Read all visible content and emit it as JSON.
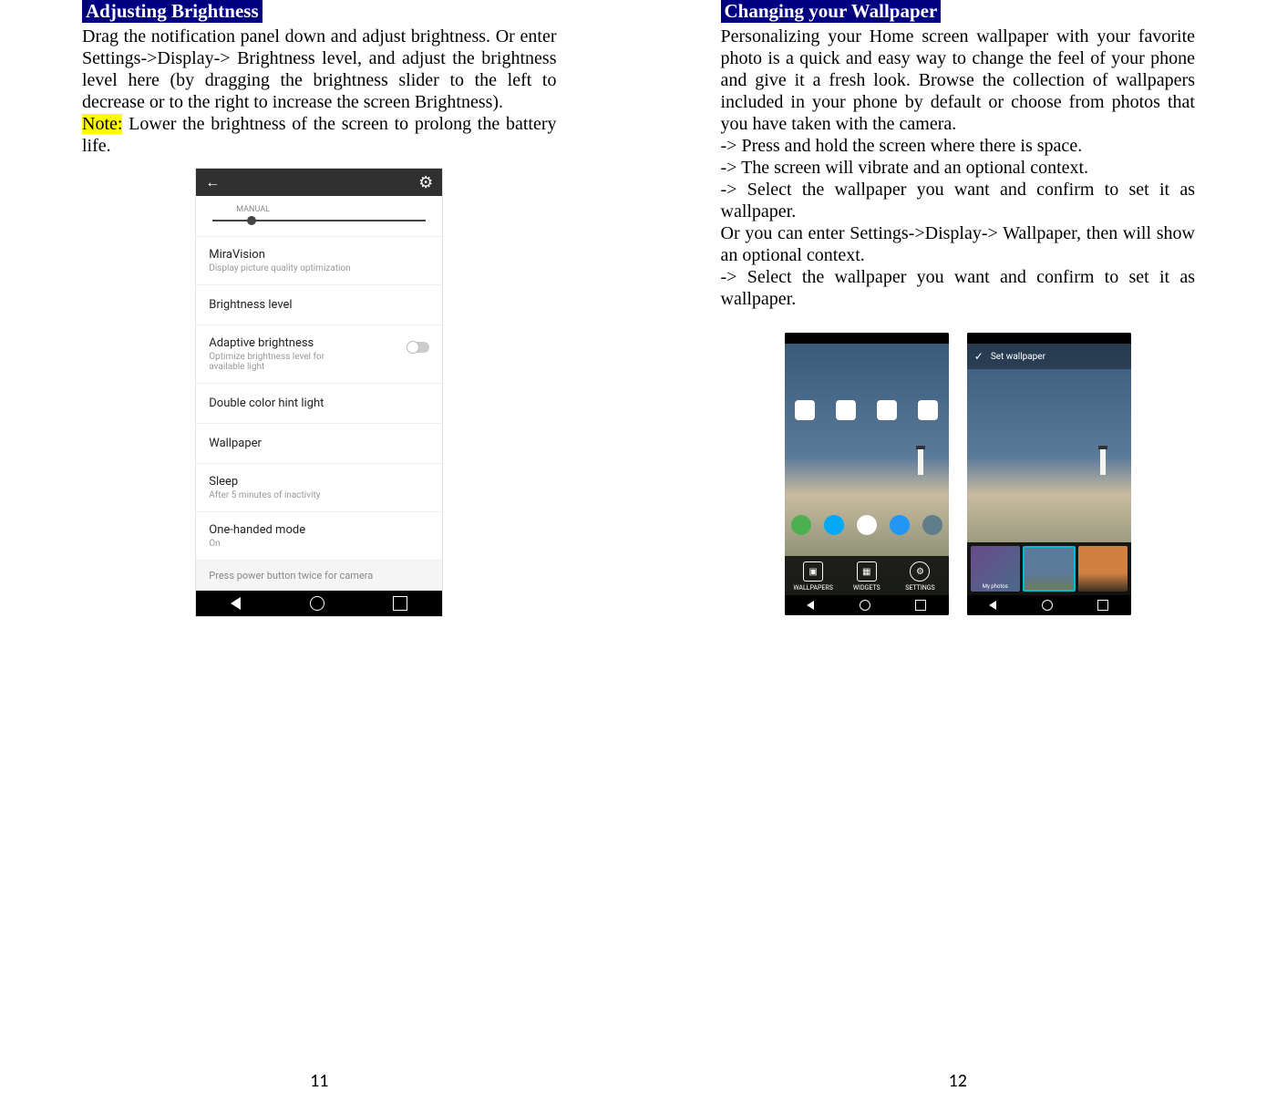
{
  "left": {
    "heading": "Adjusting Brightness",
    "body": "Drag the notification panel down and adjust brightness. Or enter Settings->Display-> Brightness level, and adjust the brightness level here (by dragging the brightness slider to the left to decrease or to the right to increase the screen Brightness).",
    "note_label": "Note:",
    "note_text": " Lower the brightness of the screen to prolong the battery life.",
    "page_number": "11",
    "screenshot": {
      "manual": "MANUAL",
      "items": [
        {
          "title": "MiraVision",
          "sub": "Display picture quality optimization"
        },
        {
          "title": "Brightness level",
          "sub": ""
        },
        {
          "title": "Adaptive brightness",
          "sub": "Optimize brightness level for available light",
          "toggle": true
        },
        {
          "title": "Double color hint light",
          "sub": ""
        },
        {
          "title": "Wallpaper",
          "sub": ""
        },
        {
          "title": "Sleep",
          "sub": "After 5 minutes of inactivity"
        },
        {
          "title": "One-handed mode",
          "sub": "On"
        }
      ],
      "press_power": "Press power button twice for camera"
    }
  },
  "right": {
    "heading": "Changing your Wallpaper",
    "body": "Personalizing your Home screen wallpaper with your favorite photo is a quick and easy way to change the feel of your phone and give it a fresh look. Browse the collection of wallpapers included in your phone by default or choose from photos that you have taken with the camera.",
    "step1": "-> Press and hold the screen where there is space.",
    "step2": "-> The screen will vibrate and an optional context.",
    "step3": "-> Select the wallpaper you want and confirm to set it as wallpaper.",
    "alt_path": "Or you can enter Settings->Display-> Wallpaper, then will show an optional context.",
    "step4": "-> Select the wallpaper you want and confirm to set it as wallpaper.",
    "page_number": "12",
    "screenshot1": {
      "overlay": [
        {
          "label": "WALLPAPERS"
        },
        {
          "label": "WIDGETS"
        },
        {
          "label": "SETTINGS"
        }
      ]
    },
    "screenshot2": {
      "header": "Set wallpaper",
      "myphotos": "My photos"
    }
  }
}
